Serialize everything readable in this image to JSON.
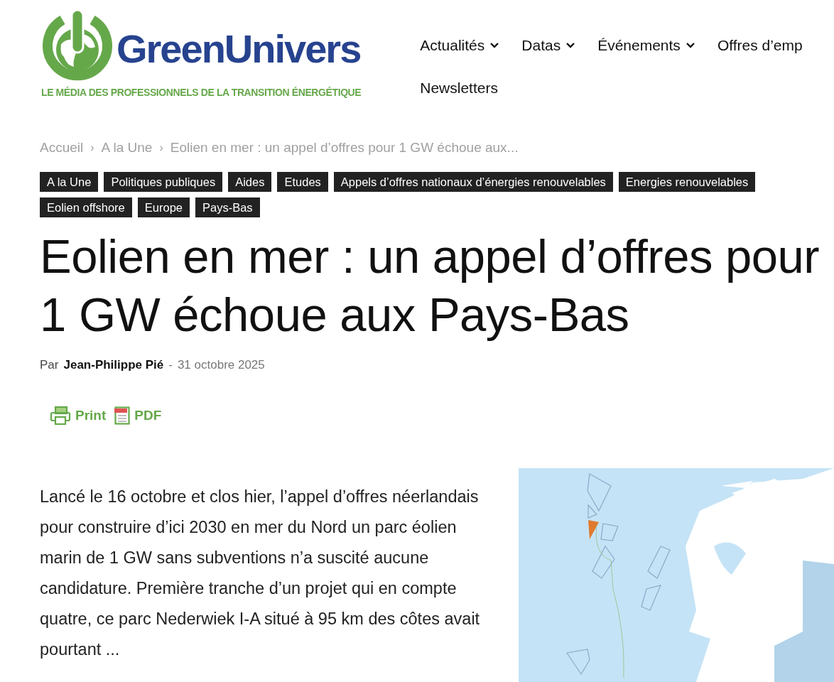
{
  "logo": {
    "name": "GreenUnivers",
    "tagline": "LE MÉDIA DES PROFESSIONNELS DE LA TRANSITION ÉNERGÉTIQUE"
  },
  "nav": [
    {
      "label": "Actualités",
      "dropdown": true
    },
    {
      "label": "Datas",
      "dropdown": true
    },
    {
      "label": "Événements",
      "dropdown": true
    },
    {
      "label": "Offres d’emp",
      "dropdown": false
    },
    {
      "label": "Newsletters",
      "dropdown": false
    }
  ],
  "breadcrumb": [
    "Accueil",
    "A la Une",
    "Eolien en mer : un appel d’offres pour 1 GW échoue aux..."
  ],
  "breadcrumb_separator": "›",
  "tags": [
    "A la Une",
    "Politiques publiques",
    "Aides",
    "Etudes",
    "Appels d’offres nationaux d’énergies renouvelables",
    "Energies renouvelables",
    "Eolien offshore",
    "Europe",
    "Pays-Bas"
  ],
  "title_lines": [
    "Eolien en mer : un appel d’offres pour",
    "1 GW échoue aux Pays-Bas"
  ],
  "byline": {
    "prefix": "Par",
    "author": "Jean-Philippe Pié",
    "separator": "-",
    "date": "31 octobre 2025"
  },
  "actions": [
    {
      "kind": "print",
      "label": "Print"
    },
    {
      "kind": "pdf",
      "label": "PDF"
    }
  ],
  "excerpt": "Lancé le 16 octobre et clos hier, l’appel d’offres néerlandais pour construire d’ici 2030 en mer du Nord un parc éolien marin de 1 GW sans subventions n’a suscité aucune candidature. Première tranche d’un projet qui en compte quatre, ce parc Nederwiek I-A situé à 95 km des côtes avait pourtant ...",
  "figure": {
    "kind": "picture"
  }
}
